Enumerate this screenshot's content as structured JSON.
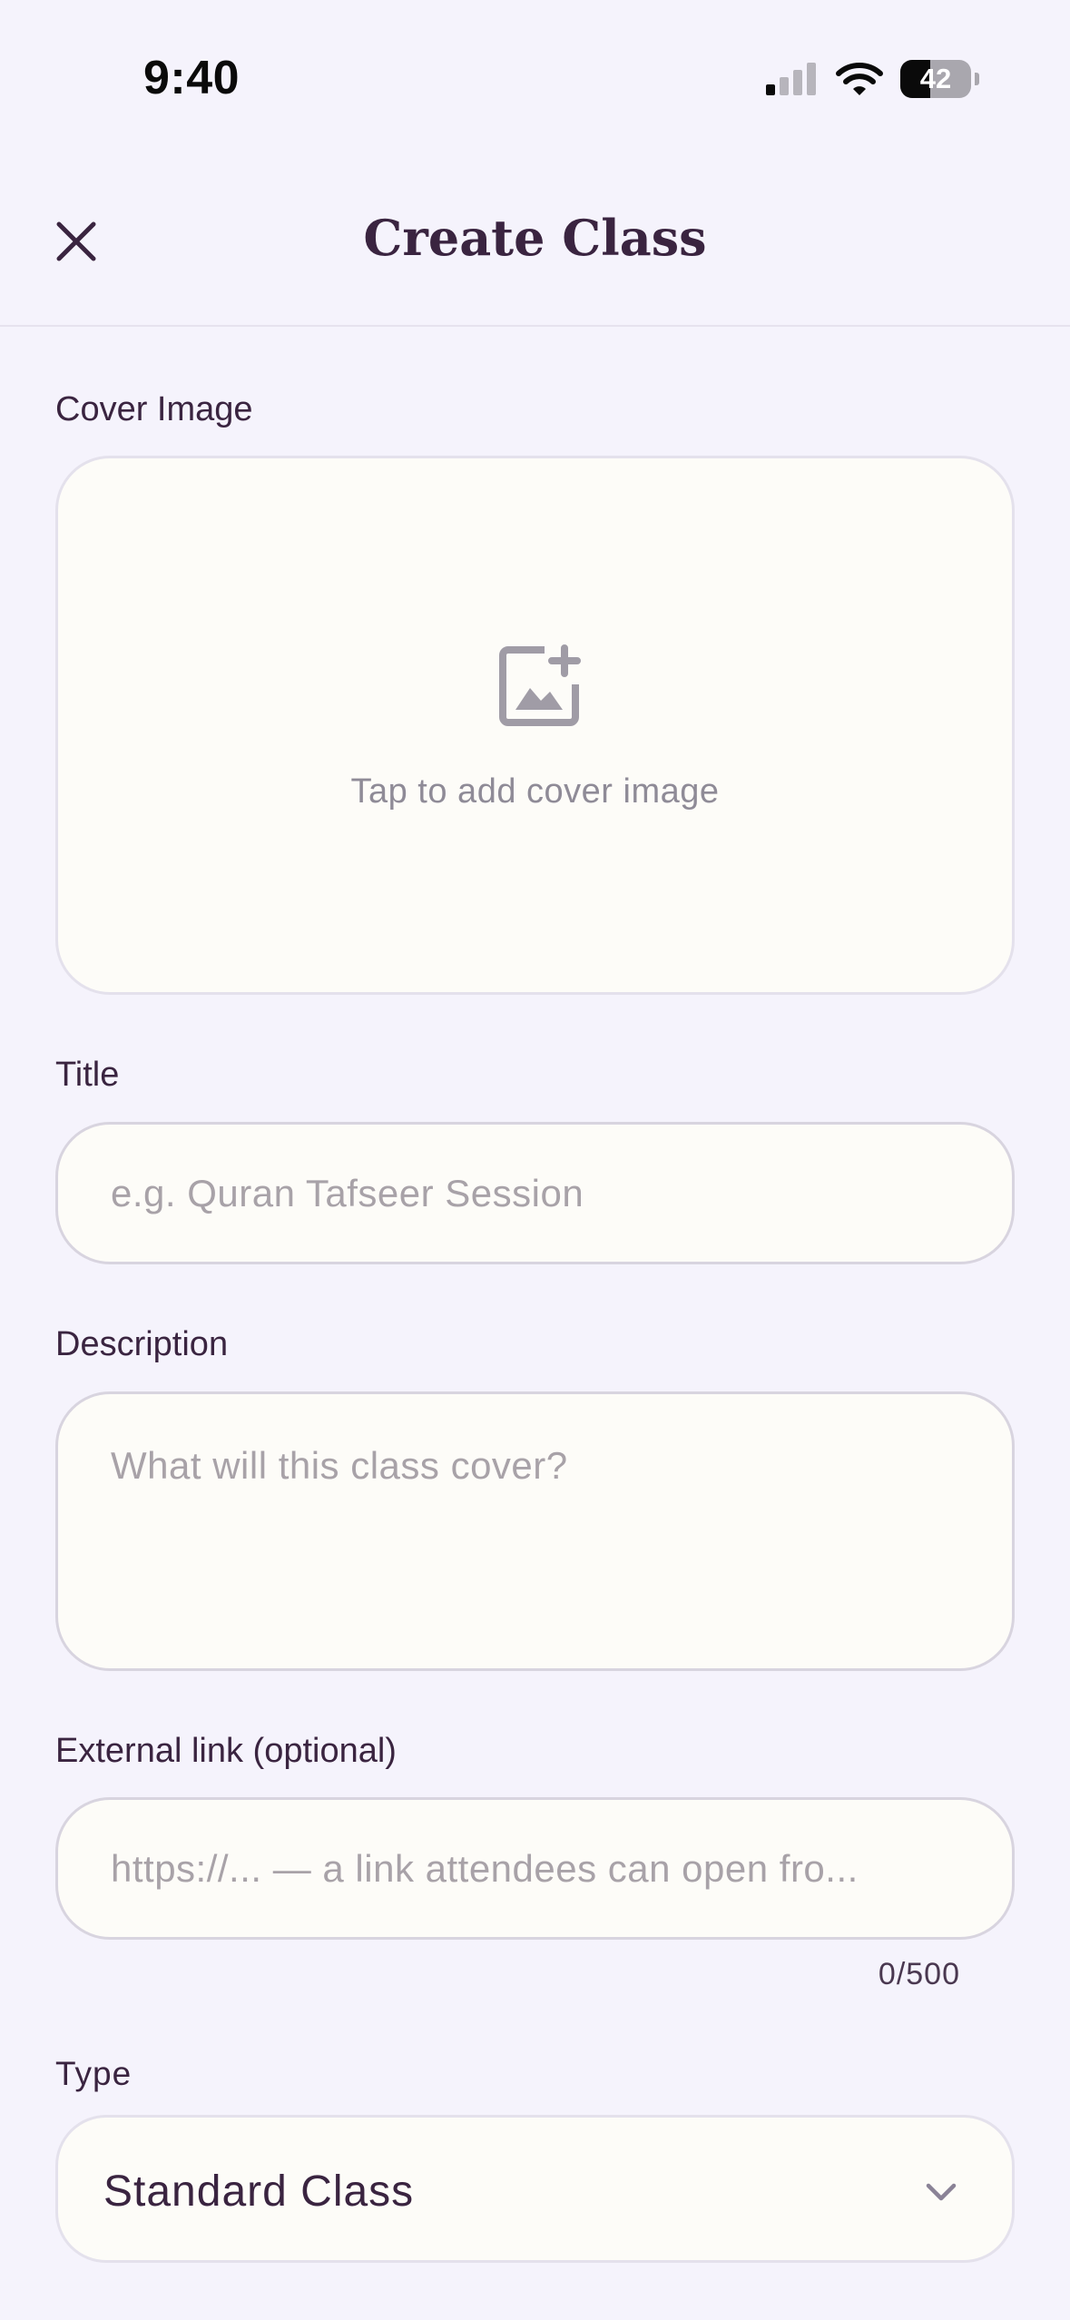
{
  "status_bar": {
    "time": "9:40",
    "battery_level": "42",
    "battery_fraction": 0.42
  },
  "header": {
    "title": "Create Class",
    "close_icon": "close-icon"
  },
  "cover_image": {
    "label": "Cover Image",
    "hint": "Tap to add cover image",
    "icon": "add-image-icon"
  },
  "title_field": {
    "label": "Title",
    "value": "",
    "placeholder": "e.g. Quran Tafseer Session"
  },
  "description_field": {
    "label": "Description",
    "value": "",
    "placeholder": "What will this class cover?"
  },
  "link_field": {
    "label": "External link (optional)",
    "value": "",
    "placeholder": "https://... — a link attendees can open fro...",
    "counter": "0/500"
  },
  "type_field": {
    "label": "Type",
    "selected": "Standard Class",
    "icon": "chevron-down-icon"
  },
  "colors": {
    "background": "#F5F3FC",
    "text": "#3A2440",
    "input_background": "#FDFCF8",
    "placeholder": "#A8A2A8"
  }
}
